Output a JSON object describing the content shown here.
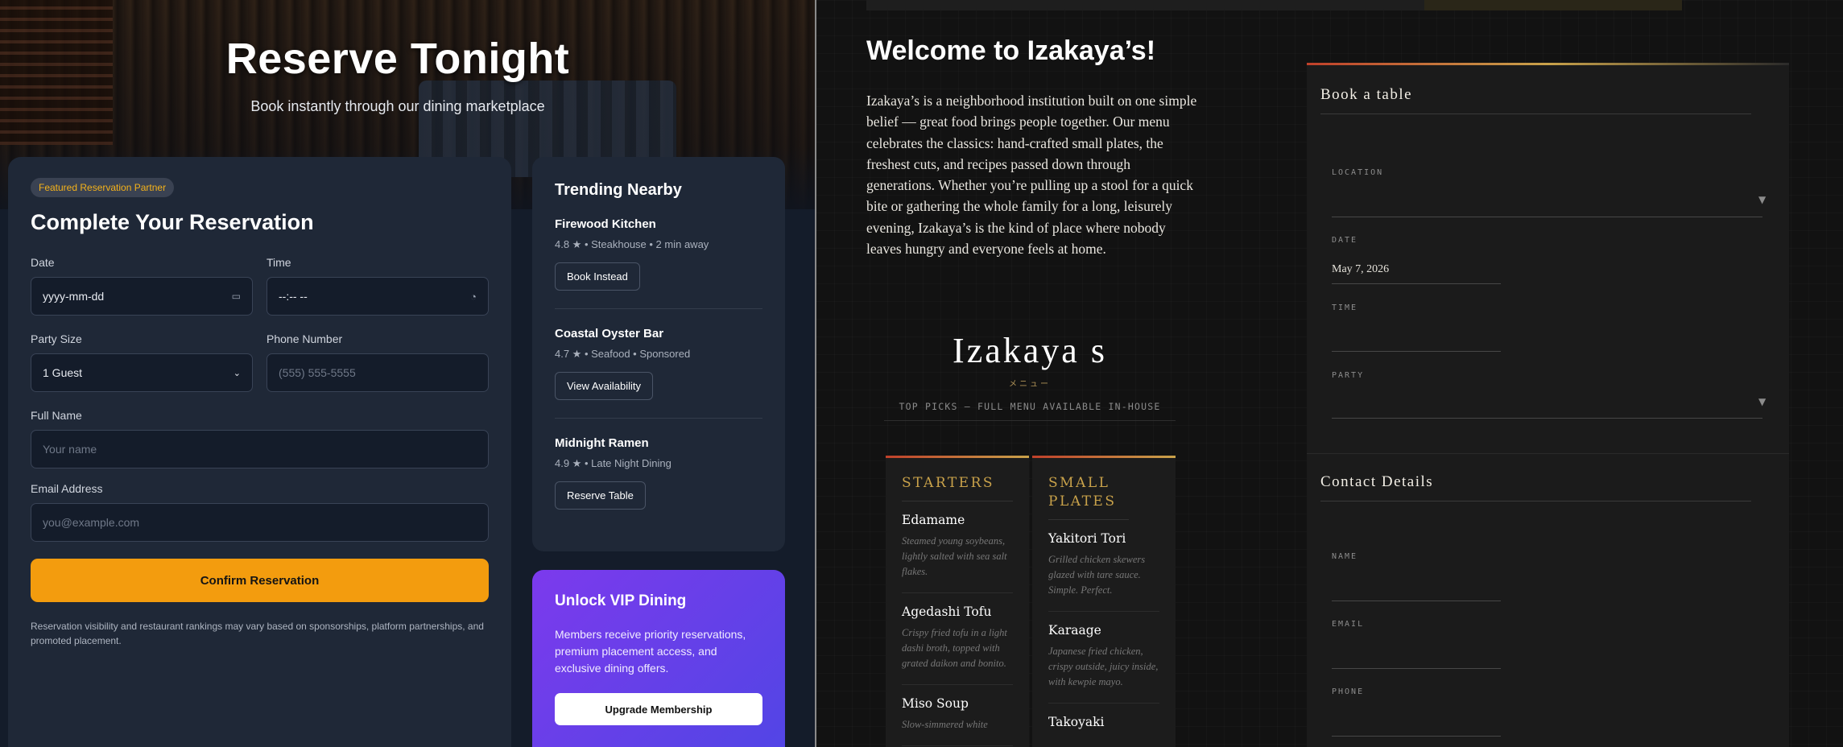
{
  "left": {
    "hero": {
      "title": "Reserve Tonight",
      "subtitle": "Book instantly through our dining marketplace"
    },
    "form": {
      "badge": "Featured Reservation Partner",
      "title": "Complete Your Reservation",
      "date_label": "Date",
      "date_value": "yyyy-mm-dd",
      "time_label": "Time",
      "time_value": "--:-- --",
      "party_label": "Party Size",
      "party_value": "1 Guest",
      "phone_label": "Phone Number",
      "phone_placeholder": "(555) 555-5555",
      "name_label": "Full Name",
      "name_placeholder": "Your name",
      "email_label": "Email Address",
      "email_placeholder": "you@example.com",
      "confirm_label": "Confirm Reservation",
      "disclaimer": "Reservation visibility and restaurant rankings may vary based on sponsorships, platform partnerships, and promoted placement."
    },
    "trending": {
      "title": "Trending Nearby",
      "items": [
        {
          "name": "Firewood Kitchen",
          "meta": "4.8 ★ • Steakhouse • 2 min away",
          "button": "Book Instead"
        },
        {
          "name": "Coastal Oyster Bar",
          "meta": "4.7 ★ • Seafood • Sponsored",
          "button": "View Availability"
        },
        {
          "name": "Midnight Ramen",
          "meta": "4.9 ★ • Late Night Dining",
          "button": "Reserve Table"
        }
      ]
    },
    "vip": {
      "title": "Unlock VIP Dining",
      "text": "Members receive priority reservations, premium placement access, and exclusive dining offers.",
      "button": "Upgrade Membership"
    }
  },
  "right": {
    "welcome": "Welcome to Izakaya’s!",
    "about": "Izakaya’s is a neighborhood institution built on one simple belief — great food brings people together. Our menu celebrates the classics: hand-crafted small plates, the freshest cuts, and recipes passed down through generations. Whether you’re pulling up a stool for a quick bite or gathering the whole family for a long, leisurely evening, Izakaya’s is the kind of place where nobody leaves hungry and everyone feels at home.",
    "menu": {
      "logo": "Izakaya s",
      "sub": "メニュー",
      "tagline": "TOP PICKS — FULL MENU AVAILABLE IN-HOUSE",
      "columns": [
        {
          "heading": "STARTERS",
          "items": [
            {
              "name": "Edamame",
              "desc": "Steamed young soybeans, lightly salted with sea salt flakes."
            },
            {
              "name": "Agedashi Tofu",
              "desc": "Crispy fried tofu in a light dashi broth, topped with grated daikon and bonito."
            },
            {
              "name": "Miso Soup",
              "desc": "Slow-simmered white"
            }
          ]
        },
        {
          "heading": "SMALL PLATES",
          "items": [
            {
              "name": "Yakitori Tori",
              "desc": "Grilled chicken skewers glazed with tare sauce. Simple. Perfect."
            },
            {
              "name": "Karaage",
              "desc": "Japanese fried chicken, crispy outside, juicy inside, with kewpie mayo."
            },
            {
              "name": "Takoyaki",
              "desc": ""
            }
          ]
        }
      ]
    },
    "booking": {
      "title": "Book a table",
      "location_label": "LOCATION",
      "date_label": "DATE",
      "date_value": "May 7, 2026",
      "time_label": "TIME",
      "party_label": "PARTY",
      "contact_title": "Contact Details",
      "name_label": "NAME",
      "email_label": "EMAIL",
      "phone_label": "PHONE"
    }
  }
}
